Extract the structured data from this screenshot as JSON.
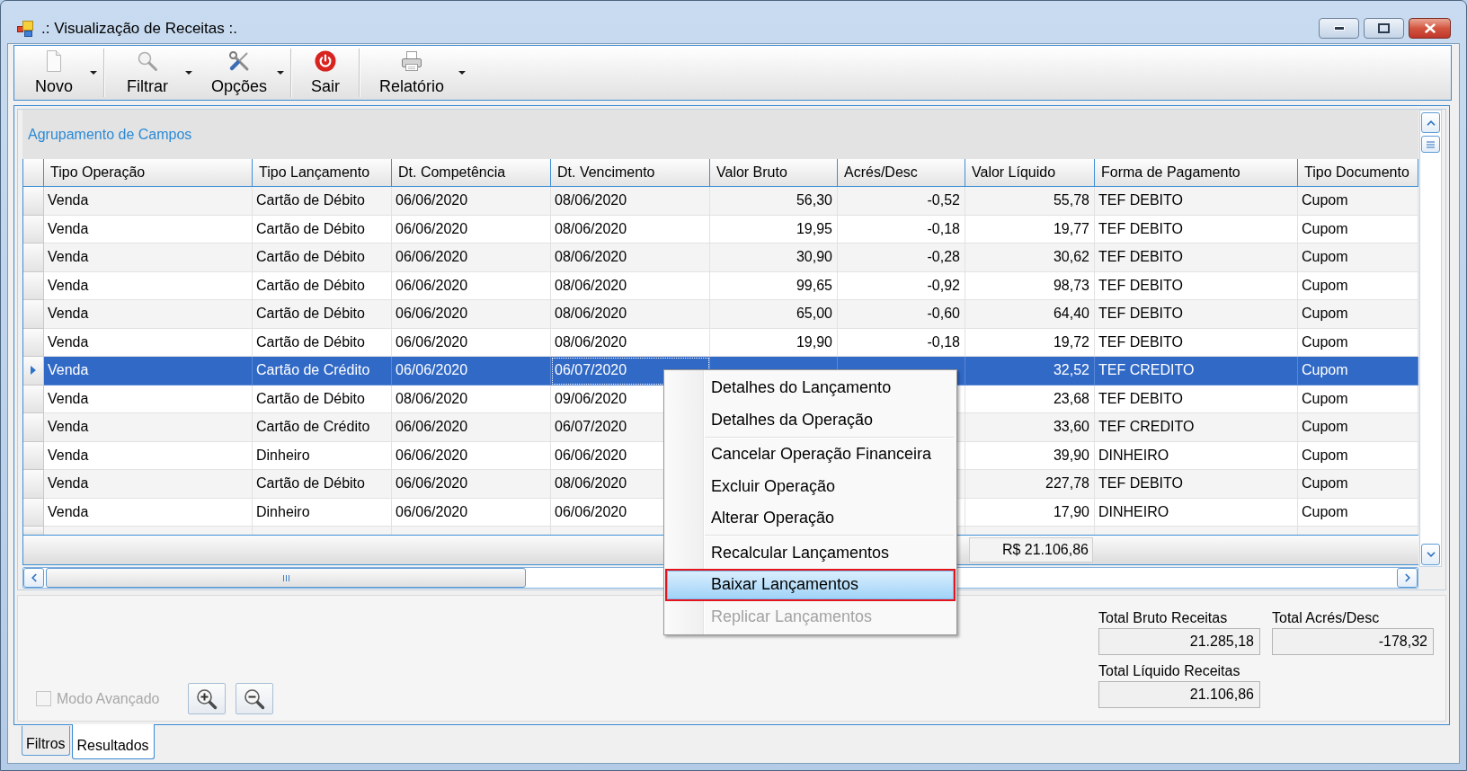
{
  "window": {
    "title": ".: Visualização de Receitas :."
  },
  "toolbar": {
    "groups": [
      {
        "buttons": [
          {
            "label": "Novo",
            "dropdown": true
          }
        ]
      },
      {
        "buttons": [
          {
            "label": "Filtrar",
            "dropdown": true
          },
          {
            "label": "Opções",
            "dropdown": true
          }
        ]
      },
      {
        "buttons": [
          {
            "label": "Sair",
            "dropdown": false
          }
        ]
      },
      {
        "buttons": [
          {
            "label": "Relatório",
            "dropdown": true
          }
        ]
      }
    ]
  },
  "grid": {
    "group_panel_hint": "Agrupamento de Campos",
    "columns": [
      {
        "label": "Tipo Operação",
        "kind": "text"
      },
      {
        "label": "Tipo Lançamento",
        "kind": "text"
      },
      {
        "label": "Dt. Competência",
        "kind": "text"
      },
      {
        "label": "Dt. Vencimento",
        "kind": "text"
      },
      {
        "label": "Valor Bruto",
        "kind": "number"
      },
      {
        "label": "Acrés/Desc",
        "kind": "number"
      },
      {
        "label": "Valor Líquido",
        "kind": "number",
        "total": "R$ 21.106,86"
      },
      {
        "label": "Forma de Pagamento",
        "kind": "text"
      },
      {
        "label": "Tipo Documento",
        "kind": "text"
      }
    ],
    "rows": [
      {
        "selected": false,
        "cells": [
          {
            "text": "Venda",
            "focused": false
          },
          {
            "text": "Cartão de Débito",
            "focused": false
          },
          {
            "text": "06/06/2020",
            "focused": false
          },
          {
            "text": "08/06/2020",
            "focused": false
          },
          {
            "text": "56,30",
            "focused": false
          },
          {
            "text": "-0,52",
            "focused": false
          },
          {
            "text": "55,78",
            "focused": false
          },
          {
            "text": "TEF DEBITO",
            "focused": false
          },
          {
            "text": "Cupom",
            "focused": false
          }
        ]
      },
      {
        "selected": false,
        "cells": [
          {
            "text": "Venda",
            "focused": false
          },
          {
            "text": "Cartão de Débito",
            "focused": false
          },
          {
            "text": "06/06/2020",
            "focused": false
          },
          {
            "text": "08/06/2020",
            "focused": false
          },
          {
            "text": "19,95",
            "focused": false
          },
          {
            "text": "-0,18",
            "focused": false
          },
          {
            "text": "19,77",
            "focused": false
          },
          {
            "text": "TEF DEBITO",
            "focused": false
          },
          {
            "text": "Cupom",
            "focused": false
          }
        ]
      },
      {
        "selected": false,
        "cells": [
          {
            "text": "Venda",
            "focused": false
          },
          {
            "text": "Cartão de Débito",
            "focused": false
          },
          {
            "text": "06/06/2020",
            "focused": false
          },
          {
            "text": "08/06/2020",
            "focused": false
          },
          {
            "text": "30,90",
            "focused": false
          },
          {
            "text": "-0,28",
            "focused": false
          },
          {
            "text": "30,62",
            "focused": false
          },
          {
            "text": "TEF DEBITO",
            "focused": false
          },
          {
            "text": "Cupom",
            "focused": false
          }
        ]
      },
      {
        "selected": false,
        "cells": [
          {
            "text": "Venda",
            "focused": false
          },
          {
            "text": "Cartão de Débito",
            "focused": false
          },
          {
            "text": "06/06/2020",
            "focused": false
          },
          {
            "text": "08/06/2020",
            "focused": false
          },
          {
            "text": "99,65",
            "focused": false
          },
          {
            "text": "-0,92",
            "focused": false
          },
          {
            "text": "98,73",
            "focused": false
          },
          {
            "text": "TEF DEBITO",
            "focused": false
          },
          {
            "text": "Cupom",
            "focused": false
          }
        ]
      },
      {
        "selected": false,
        "cells": [
          {
            "text": "Venda",
            "focused": false
          },
          {
            "text": "Cartão de Débito",
            "focused": false
          },
          {
            "text": "06/06/2020",
            "focused": false
          },
          {
            "text": "08/06/2020",
            "focused": false
          },
          {
            "text": "65,00",
            "focused": false
          },
          {
            "text": "-0,60",
            "focused": false
          },
          {
            "text": "64,40",
            "focused": false
          },
          {
            "text": "TEF DEBITO",
            "focused": false
          },
          {
            "text": "Cupom",
            "focused": false
          }
        ]
      },
      {
        "selected": false,
        "cells": [
          {
            "text": "Venda",
            "focused": false
          },
          {
            "text": "Cartão de Débito",
            "focused": false
          },
          {
            "text": "06/06/2020",
            "focused": false
          },
          {
            "text": "08/06/2020",
            "focused": false
          },
          {
            "text": "19,90",
            "focused": false
          },
          {
            "text": "-0,18",
            "focused": false
          },
          {
            "text": "19,72",
            "focused": false
          },
          {
            "text": "TEF DEBITO",
            "focused": false
          },
          {
            "text": "Cupom",
            "focused": false
          }
        ]
      },
      {
        "selected": true,
        "cells": [
          {
            "text": "Venda",
            "focused": false
          },
          {
            "text": "Cartão de Crédito",
            "focused": false
          },
          {
            "text": "06/06/2020",
            "focused": false
          },
          {
            "text": "06/07/2020",
            "focused": true
          },
          null,
          null,
          {
            "text": "32,52",
            "focused": false
          },
          {
            "text": "TEF CREDITO",
            "focused": false
          },
          {
            "text": "Cupom",
            "focused": false
          }
        ]
      },
      {
        "selected": false,
        "cells": [
          {
            "text": "Venda",
            "focused": false
          },
          {
            "text": "Cartão de Débito",
            "focused": false
          },
          {
            "text": "08/06/2020",
            "focused": false
          },
          {
            "text": "09/06/2020",
            "focused": false
          },
          null,
          null,
          {
            "text": "23,68",
            "focused": false
          },
          {
            "text": "TEF DEBITO",
            "focused": false
          },
          {
            "text": "Cupom",
            "focused": false
          }
        ]
      },
      {
        "selected": false,
        "cells": [
          {
            "text": "Venda",
            "focused": false
          },
          {
            "text": "Cartão de Crédito",
            "focused": false
          },
          {
            "text": "06/06/2020",
            "focused": false
          },
          {
            "text": "06/07/2020",
            "focused": false
          },
          null,
          null,
          {
            "text": "33,60",
            "focused": false
          },
          {
            "text": "TEF CREDITO",
            "focused": false
          },
          {
            "text": "Cupom",
            "focused": false
          }
        ]
      },
      {
        "selected": false,
        "cells": [
          {
            "text": "Venda",
            "focused": false
          },
          {
            "text": "Dinheiro",
            "focused": false
          },
          {
            "text": "06/06/2020",
            "focused": false
          },
          {
            "text": "06/06/2020",
            "focused": false
          },
          null,
          null,
          {
            "text": "39,90",
            "focused": false
          },
          {
            "text": "DINHEIRO",
            "focused": false
          },
          {
            "text": "Cupom",
            "focused": false
          }
        ]
      },
      {
        "selected": false,
        "cells": [
          {
            "text": "Venda",
            "focused": false
          },
          {
            "text": "Cartão de Débito",
            "focused": false
          },
          {
            "text": "06/06/2020",
            "focused": false
          },
          {
            "text": "08/06/2020",
            "focused": false
          },
          null,
          null,
          {
            "text": "227,78",
            "focused": false
          },
          {
            "text": "TEF DEBITO",
            "focused": false
          },
          {
            "text": "Cupom",
            "focused": false
          }
        ]
      },
      {
        "selected": false,
        "cells": [
          {
            "text": "Venda",
            "focused": false
          },
          {
            "text": "Dinheiro",
            "focused": false
          },
          {
            "text": "06/06/2020",
            "focused": false
          },
          {
            "text": "06/06/2020",
            "focused": false
          },
          null,
          null,
          {
            "text": "17,90",
            "focused": false
          },
          {
            "text": "DINHEIRO",
            "focused": false
          },
          {
            "text": "Cupom",
            "focused": false
          }
        ]
      }
    ]
  },
  "context_menu": {
    "items": [
      {
        "kind": "item",
        "label": "Detalhes do Lançamento",
        "highlighted": false,
        "disabled": false,
        "annotated": false
      },
      {
        "kind": "item",
        "label": "Detalhes da Operação",
        "highlighted": false,
        "disabled": false,
        "annotated": false
      },
      {
        "kind": "separator"
      },
      {
        "kind": "item",
        "label": "Cancelar Operação Financeira",
        "highlighted": false,
        "disabled": false,
        "annotated": false
      },
      {
        "kind": "item",
        "label": "Excluir Operação",
        "highlighted": false,
        "disabled": false,
        "annotated": false
      },
      {
        "kind": "item",
        "label": "Alterar Operação",
        "highlighted": false,
        "disabled": false,
        "annotated": false
      },
      {
        "kind": "separator"
      },
      {
        "kind": "item",
        "label": "Recalcular Lançamentos",
        "highlighted": false,
        "disabled": false,
        "annotated": false
      },
      {
        "kind": "item",
        "label": "Baixar Lançamentos",
        "highlighted": true,
        "disabled": false,
        "annotated": true
      },
      {
        "kind": "item",
        "label": "Replicar Lançamentos",
        "highlighted": false,
        "disabled": true,
        "annotated": false
      }
    ]
  },
  "bottom_panel": {
    "advanced_mode": {
      "label": "Modo Avançado",
      "checked": false,
      "disabled": true
    },
    "totals": [
      {
        "label": "Total Bruto Receitas",
        "value": "21.285,18"
      },
      {
        "label": "Total Acrés/Desc",
        "value": "-178,32"
      },
      {
        "label": "Total Líquido Receitas",
        "value": "21.106,86"
      }
    ]
  },
  "tabs": [
    {
      "label": "Filtros",
      "selected": false
    },
    {
      "label": "Resultados",
      "selected": true
    }
  ]
}
